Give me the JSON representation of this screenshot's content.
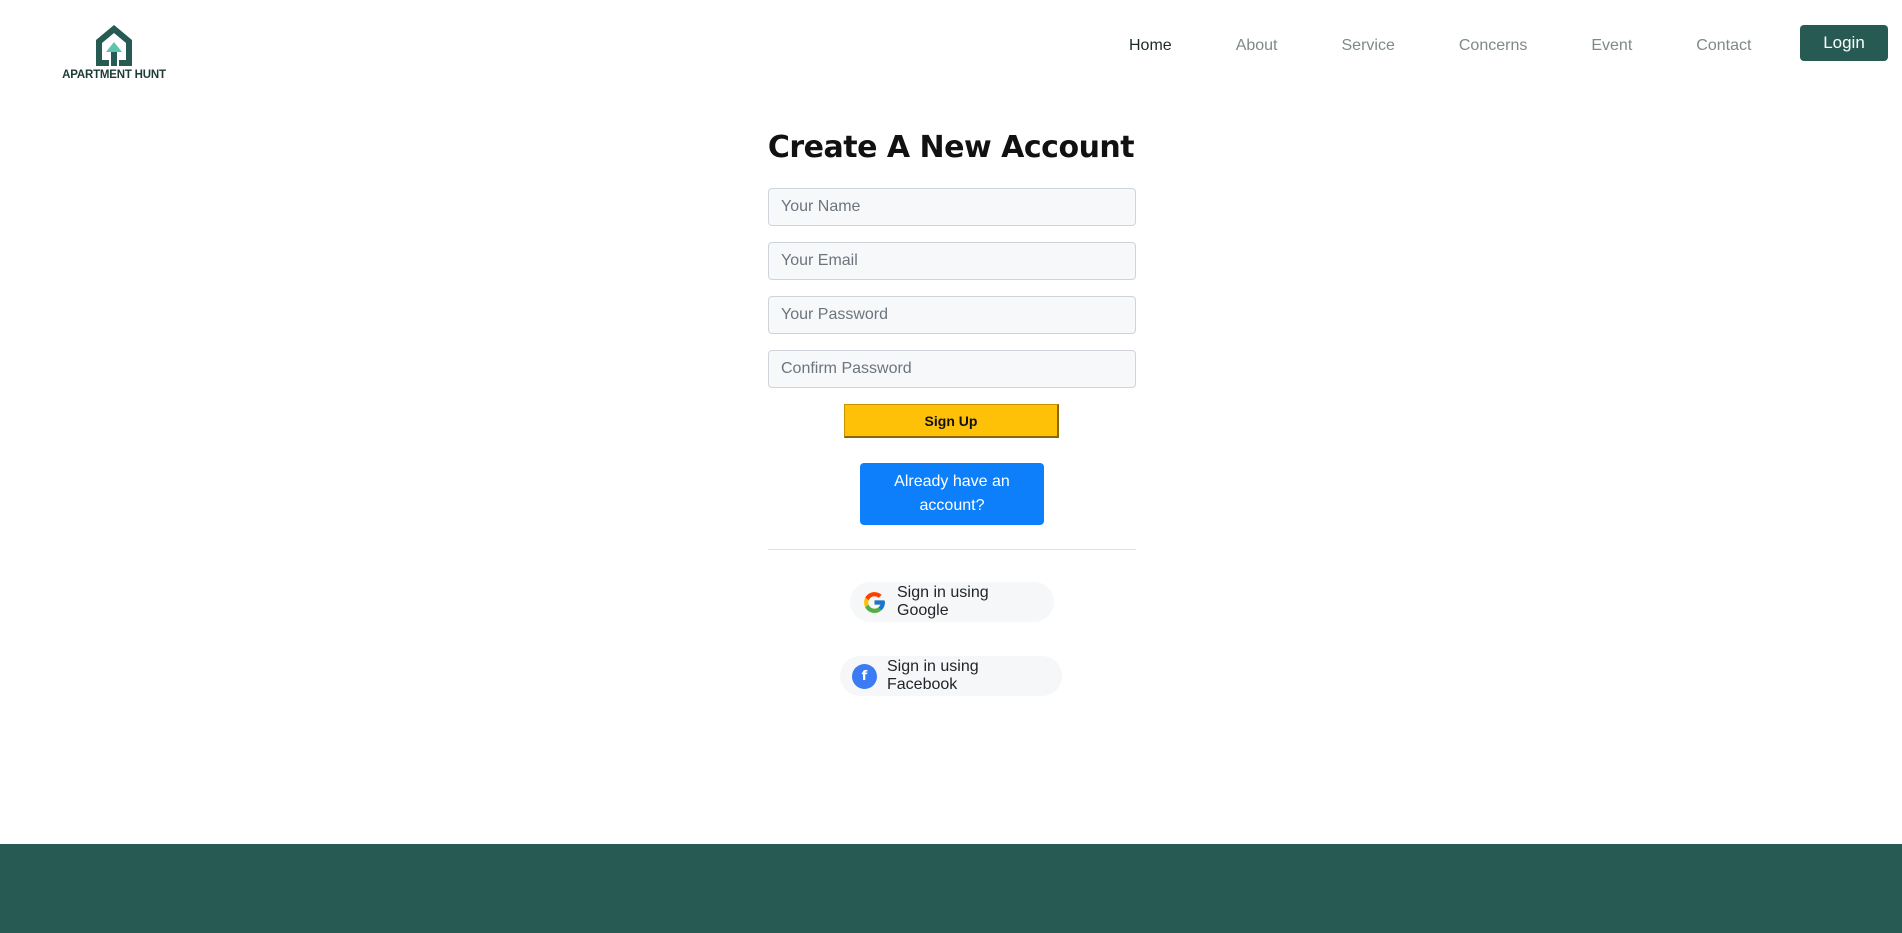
{
  "brand": {
    "name": "APARTMENT HUNT"
  },
  "nav": {
    "items": [
      {
        "label": "Home",
        "active": true
      },
      {
        "label": "About"
      },
      {
        "label": "Service"
      },
      {
        "label": "Concerns"
      },
      {
        "label": "Event"
      },
      {
        "label": "Contact"
      }
    ],
    "login_label": "Login"
  },
  "form": {
    "title": "Create A New Account",
    "name_placeholder": "Your Name",
    "email_placeholder": "Your Email",
    "password_placeholder": "Your Password",
    "confirm_placeholder": "Confirm Password",
    "signup_label": "Sign Up",
    "have_account_label": "Already have an account?"
  },
  "social": {
    "google_label": "Sign in using Google",
    "facebook_label": "Sign in using Facebook",
    "facebook_letter": "f"
  },
  "colors": {
    "brand": "#275a52",
    "signup": "#ffc107",
    "primary": "#0d7ffb",
    "facebook": "#3b7bf3"
  }
}
